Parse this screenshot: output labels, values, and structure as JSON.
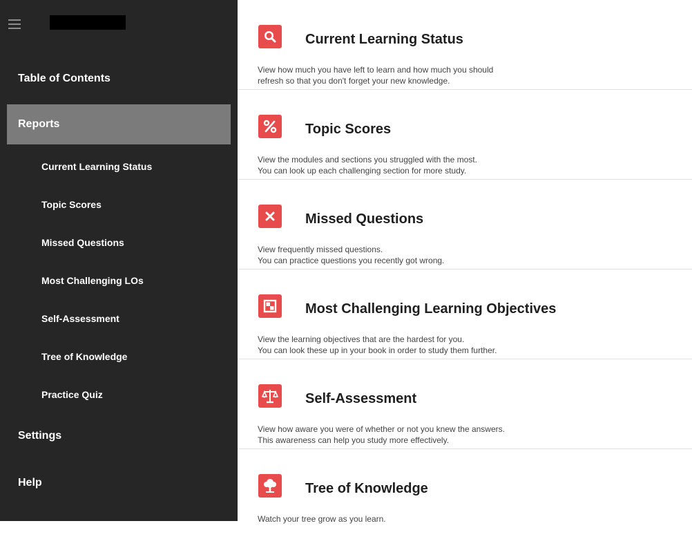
{
  "sidebar": {
    "table_of_contents": "Table of Contents",
    "reports": "Reports",
    "sub_items": [
      "Current Learning Status",
      "Topic Scores",
      "Missed Questions",
      "Most Challenging LOs",
      "Self-Assessment",
      "Tree of Knowledge",
      "Practice Quiz"
    ],
    "settings": "Settings",
    "help": "Help"
  },
  "main": {
    "sections": [
      {
        "icon": "search-icon",
        "title": "Current Learning Status",
        "lines": [
          "View how much you have left to learn and how much you should",
          "refresh so that you don't forget your new knowledge."
        ]
      },
      {
        "icon": "percent-icon",
        "title": "Topic Scores",
        "lines": [
          "View the modules and sections you struggled with the most.",
          "You can look up each challenging section for more study."
        ]
      },
      {
        "icon": "close-icon",
        "title": "Missed Questions",
        "lines": [
          "View frequently missed questions.",
          "You can practice questions you recently got wrong."
        ]
      },
      {
        "icon": "checker-icon",
        "title": "Most Challenging Learning Objectives",
        "lines": [
          "View the learning objectives that are the hardest for you.",
          "You can look these up in your book in order to study them further."
        ]
      },
      {
        "icon": "scale-icon",
        "title": "Self-Assessment",
        "lines": [
          "View how aware you were of whether or not you knew the answers.",
          "This awareness can help you study more effectively."
        ]
      },
      {
        "icon": "tree-icon",
        "title": "Tree of Knowledge",
        "lines": [
          "Watch your tree grow as you learn."
        ]
      }
    ]
  },
  "colors": {
    "sidebar_bg": "#262626",
    "active_bg": "#7b7b7b",
    "accent": "#e84b4b"
  }
}
